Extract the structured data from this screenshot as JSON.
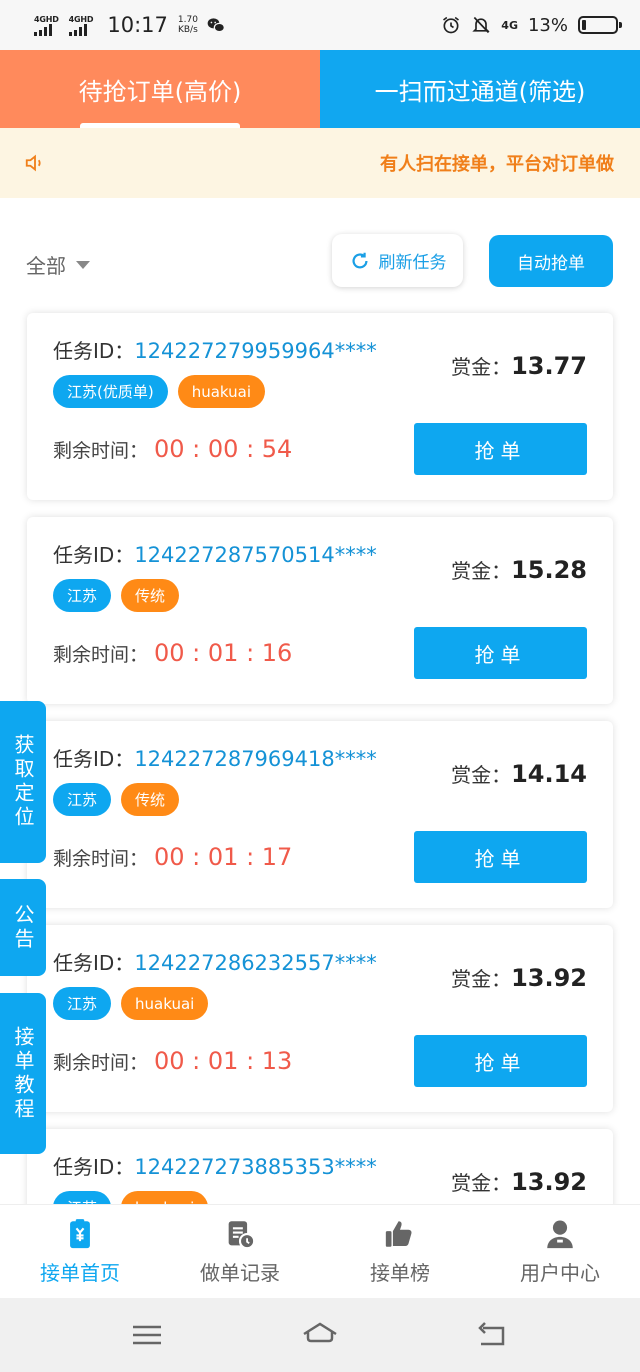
{
  "status_bar": {
    "network_1": "4GHD",
    "network_2": "4GHD",
    "time": "10:17",
    "speed_value": "1.70",
    "speed_unit": "KB/s",
    "right_network": "4G",
    "battery_percent": "13%",
    "battery_level": 0.13
  },
  "tabs": [
    {
      "label": "待抢订单(高价)",
      "active": true
    },
    {
      "label": "一扫而过通道(筛选)",
      "active": false
    }
  ],
  "notice": {
    "text": "有人扫在接单，平台对订单做"
  },
  "filter": {
    "label": "全部"
  },
  "buttons": {
    "refresh": "刷新任务",
    "auto": "自动抢单"
  },
  "labels": {
    "task_id": "任务ID：",
    "reward": "赏金：",
    "remaining": "剩余时间：",
    "grab": "抢单"
  },
  "orders": [
    {
      "id": "124227279959964****",
      "tags": [
        "江苏(优质单)",
        "huakuai"
      ],
      "remaining": "00 : 00 : 54",
      "reward": "13.77"
    },
    {
      "id": "124227287570514****",
      "tags": [
        "江苏",
        "传统"
      ],
      "remaining": "00 : 01 : 16",
      "reward": "15.28"
    },
    {
      "id": "124227287969418****",
      "tags": [
        "江苏",
        "传统"
      ],
      "remaining": "00 : 01 : 17",
      "reward": "14.14"
    },
    {
      "id": "124227286232557****",
      "tags": [
        "江苏",
        "huakuai"
      ],
      "remaining": "00 : 01 : 13",
      "reward": "13.92"
    },
    {
      "id": "124227273885353****",
      "tags": [
        "江苏",
        "huakuai"
      ],
      "remaining": "",
      "reward": "13.92"
    }
  ],
  "side_tabs": [
    {
      "label": "获取定位"
    },
    {
      "label": "公告"
    },
    {
      "label": "接单教程"
    }
  ],
  "bottom_nav": [
    {
      "label": "接单首页",
      "icon": "clipboard-yen-icon",
      "active": true
    },
    {
      "label": "做单记录",
      "icon": "document-clock-icon",
      "active": false
    },
    {
      "label": "接单榜",
      "icon": "thumbs-up-icon",
      "active": false
    },
    {
      "label": "用户中心",
      "icon": "user-icon",
      "active": false
    }
  ],
  "colors": {
    "primary": "#0ea7f0",
    "orange_tab": "#ff8a5c",
    "tag_orange": "#ff8a16",
    "timer_red": "#f05a4a",
    "notice_text": "#f07f1a",
    "notice_bg": "#fdf5e2"
  }
}
